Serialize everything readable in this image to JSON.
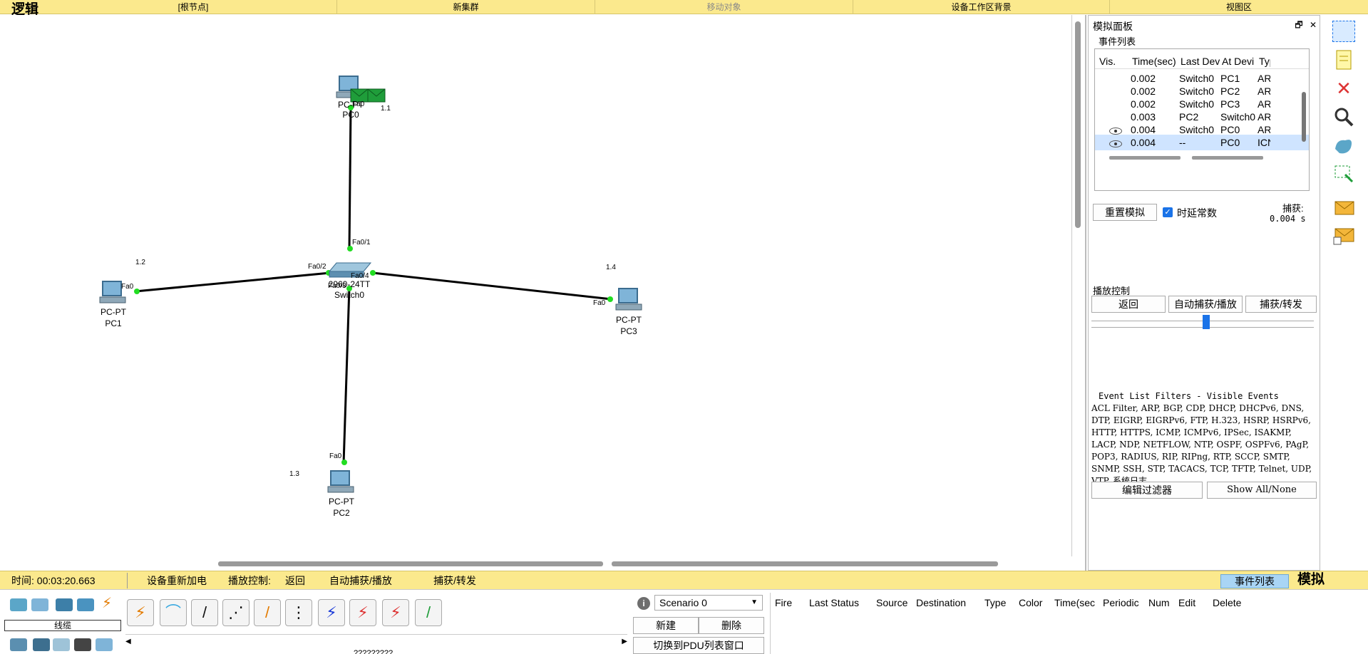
{
  "topbar": {
    "mode": "逻辑",
    "root_node": "[根节点]",
    "new_cluster": "新集群",
    "move_object": "移动对象",
    "set_background": "设备工作区背景",
    "viewport": "视图区"
  },
  "workspace": {
    "devices": [
      {
        "type": "PC-PT",
        "name": "PC0"
      },
      {
        "type": "PC-PT",
        "name": "PC1"
      },
      {
        "type": "PC-PT",
        "name": "PC2"
      },
      {
        "type": "PC-PT",
        "name": "PC3"
      },
      {
        "type": "2960-24TT",
        "name": "Switch0"
      }
    ],
    "ports": [
      "Fa0",
      "Fa0",
      "Fa0",
      "Fa0",
      "Fa0/1",
      "Fa0/2",
      "Fa0/3",
      "Fa0/4"
    ],
    "ip_notes": [
      "1.1",
      "1.2",
      "1.3",
      "1.4"
    ],
    "pdu_colors": {
      "envelope": "#1f9d3a",
      "link": "#000000",
      "port_dot": "#22dd22"
    }
  },
  "sim_panel": {
    "title": "模拟面板",
    "restore_btn": "🗗",
    "close_btn": "✕",
    "event_list_label": "事件列表",
    "columns": [
      "Vis.",
      "Time(sec)",
      "Last Dev",
      "At Devi",
      "Typ"
    ],
    "events": [
      {
        "vis": "",
        "time": "0.002",
        "last": "Switch0",
        "at": "PC1",
        "type": "ARI"
      },
      {
        "vis": "",
        "time": "0.002",
        "last": "Switch0",
        "at": "PC2",
        "type": "ARI"
      },
      {
        "vis": "",
        "time": "0.002",
        "last": "Switch0",
        "at": "PC3",
        "type": "ARI"
      },
      {
        "vis": "",
        "time": "0.003",
        "last": "PC2",
        "at": "Switch0",
        "type": "ARI"
      },
      {
        "vis": "eye",
        "time": "0.004",
        "last": "Switch0",
        "at": "PC0",
        "type": "ARI"
      },
      {
        "vis": "eye",
        "time": "0.004",
        "last": "--",
        "at": "PC0",
        "type": "ICN"
      }
    ],
    "reset_sim": "重置模拟",
    "constant_delay": "时延常数",
    "constant_delay_checked": true,
    "capture_label": "捕获:",
    "capture_value": "0.004 s",
    "play_control_label": "播放控制",
    "back_btn": "返回",
    "auto_capture_btn": "自动捕获/播放",
    "capture_forward_btn": "捕获/转发",
    "speed_fraction": 0.42,
    "filters_title": "Event List Filters - Visible Events",
    "filters_text": "ACL Filter, ARP, BGP, CDP, DHCP, DHCPv6, DNS, DTP, EIGRP, EIGRPv6, FTP, H.323, HSRP, HSRPv6, HTTP, HTTPS, ICMP, ICMPv6, IPSec, ISAKMP, LACP, NDP, NETFLOW, NTP, OSPF, OSPFv6, PAgP, POP3, RADIUS, RIP, RIPng, RTP, SCCP, SMTP, SNMP, SSH, STP, TACACS, TCP, TFTP, Telnet, UDP, VTP, 系统日志",
    "edit_filters": "编辑过滤器",
    "show_all": "Show All/None"
  },
  "right_toolbar": [
    "select-icon",
    "note-icon",
    "delete-icon",
    "inspect-icon",
    "shape-icon",
    "resize-icon",
    "add-simple-pdu-icon",
    "add-complex-pdu-icon"
  ],
  "statusbar": {
    "time": "时间: 00:03:20.663",
    "power_cycle": "设备重新加电",
    "play_control": "播放控制:",
    "back": "返回",
    "auto_capture": "自动捕获/播放",
    "capture_forward": "捕获/转发",
    "event_list_tab": "事件列表",
    "mode": "模拟"
  },
  "bottom": {
    "category_label": "线缆",
    "connection_name": "?????????",
    "scenario": "Scenario 0",
    "new_btn": "新建",
    "delete_btn": "删除",
    "toggle_pdu_list": "切换到PDU列表窗口",
    "pdu_columns": [
      "Fire",
      "Last Status",
      "Source",
      "Destination",
      "Type",
      "Color",
      "Time(sec",
      "Periodic",
      "Num",
      "Edit",
      "Delete"
    ]
  }
}
